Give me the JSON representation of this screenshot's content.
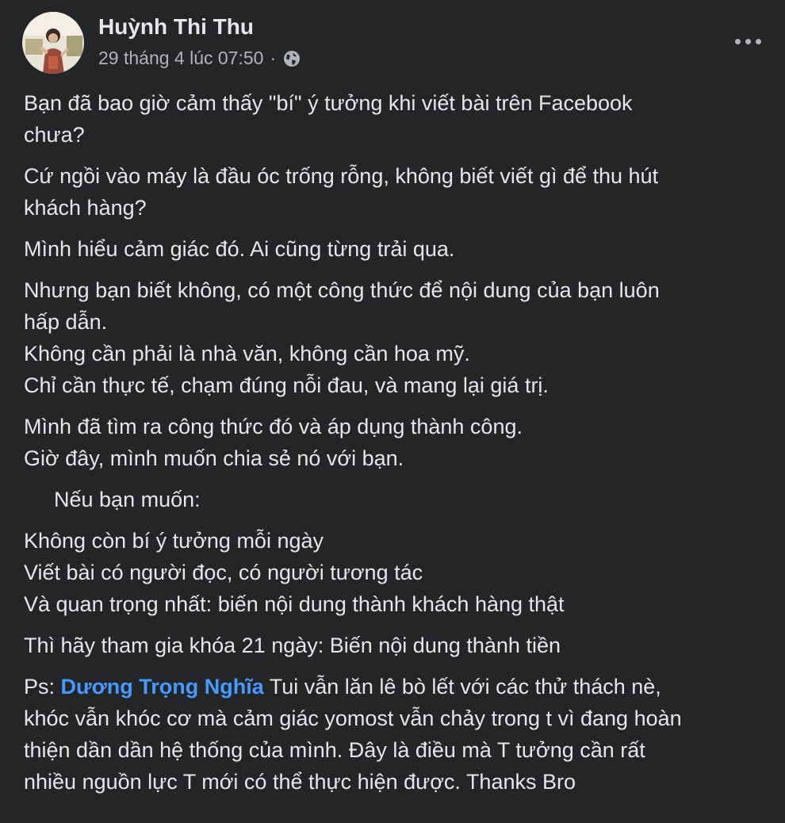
{
  "post": {
    "author": "Huỳnh Thi Thu",
    "timestamp": "29 tháng 4 lúc 07:50",
    "separator": "·",
    "privacy_icon": "globe-icon",
    "more_icon": "more-options-icon",
    "paragraphs": [
      [
        "Bạn đã bao giờ cảm thấy \"bí\" ý tưởng khi viết bài trên Facebook",
        "chưa?"
      ],
      [
        "Cứ ngồi vào máy là đầu óc trống rỗng, không biết viết gì để thu hút",
        "khách hàng?"
      ],
      [
        "Mình hiểu cảm giác đó. Ai cũng từng trải qua."
      ],
      [
        "Nhưng bạn biết không, có một công thức để nội dung của bạn luôn",
        "hấp dẫn.",
        "Không cần phải là nhà văn, không cần hoa mỹ.",
        "Chỉ cần thực tế, chạm đúng nỗi đau, và mang lại giá trị."
      ],
      [
        "Mình đã tìm ra công thức đó và áp dụng thành công.",
        "Giờ đây, mình muốn chia sẻ nó với bạn."
      ],
      [
        "Nếu bạn muốn:"
      ],
      [
        "Không còn bí ý tưởng mỗi ngày",
        "Viết bài có người đọc, có người tương tác",
        "Và quan trọng nhất: biến nội dung thành khách hàng thật"
      ],
      [
        "Thì hãy tham gia khóa 21 ngày: Biến nội dung thành tiền"
      ]
    ],
    "ps": {
      "prefix": "Ps: ",
      "mention": "Dương Trọng Nghĩa",
      "first_line_rest": " Tui vẫn lăn lê bò lết với các thử thách nè,",
      "lines": [
        "khóc vẫn khóc cơ mà cảm giác yomost vẫn chảy trong t vì đang hoàn",
        "thiện dần dần hệ thống của mình. Đây là điều mà T tưởng cần rất",
        "nhiều nguồn lực T mới có thể thực hiện được. Thanks Bro"
      ]
    },
    "colors": {
      "background": "#242526",
      "text": "#e4e6eb",
      "secondary": "#b0b3b8",
      "mention": "#4599ff"
    }
  }
}
